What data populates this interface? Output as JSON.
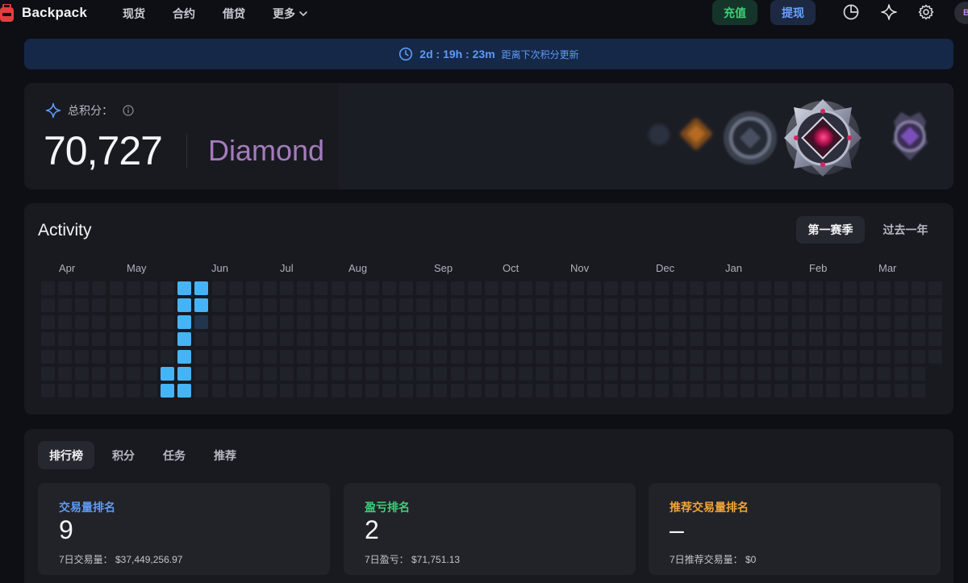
{
  "nav": {
    "brand": "Backpack",
    "links": [
      "现货",
      "合约",
      "借贷",
      "更多"
    ],
    "deposit": "充值",
    "withdraw": "提现",
    "avatar_initial": "B"
  },
  "banner": {
    "countdown": "2d : 19h : 23m",
    "text": "距离下次积分更新"
  },
  "points": {
    "label": "总积分：",
    "value": "70,727",
    "tier": "Diamond",
    "tier_color": "#a57bbd"
  },
  "activity": {
    "title": "Activity",
    "tabs": [
      "第一赛季",
      "过去一年"
    ],
    "months": [
      "Apr",
      "May",
      "Jun",
      "Jul",
      "Aug",
      "Sep",
      "Oct",
      "Nov",
      "Dec",
      "Jan",
      "Feb",
      "Mar"
    ],
    "active_cells": [
      [
        7,
        6
      ],
      [
        8,
        6
      ],
      [
        7,
        5
      ],
      [
        8,
        5
      ],
      [
        8,
        4
      ],
      [
        8,
        3
      ],
      [
        8,
        2
      ],
      [
        9,
        0
      ],
      [
        8,
        0
      ],
      [
        9,
        1
      ],
      [
        8,
        1
      ]
    ],
    "dim_cells": [
      [
        9,
        2
      ]
    ],
    "accent_color": "#45b4f6"
  },
  "leaderboard": {
    "tabs": [
      "排行榜",
      "积分",
      "任务",
      "推荐"
    ],
    "cards": [
      {
        "title": "交易量排名",
        "title_color": "#5e9bf5",
        "value": "9",
        "sub": "7日交易量： $37,449,256.97"
      },
      {
        "title": "盈亏排名",
        "title_color": "#3ed07a",
        "value": "2",
        "sub": "7日盈亏： $71,751.13"
      },
      {
        "title": "推荐交易量排名",
        "title_color": "#f0a43a",
        "value": "–",
        "sub": "7日推荐交易量： $0"
      }
    ]
  }
}
